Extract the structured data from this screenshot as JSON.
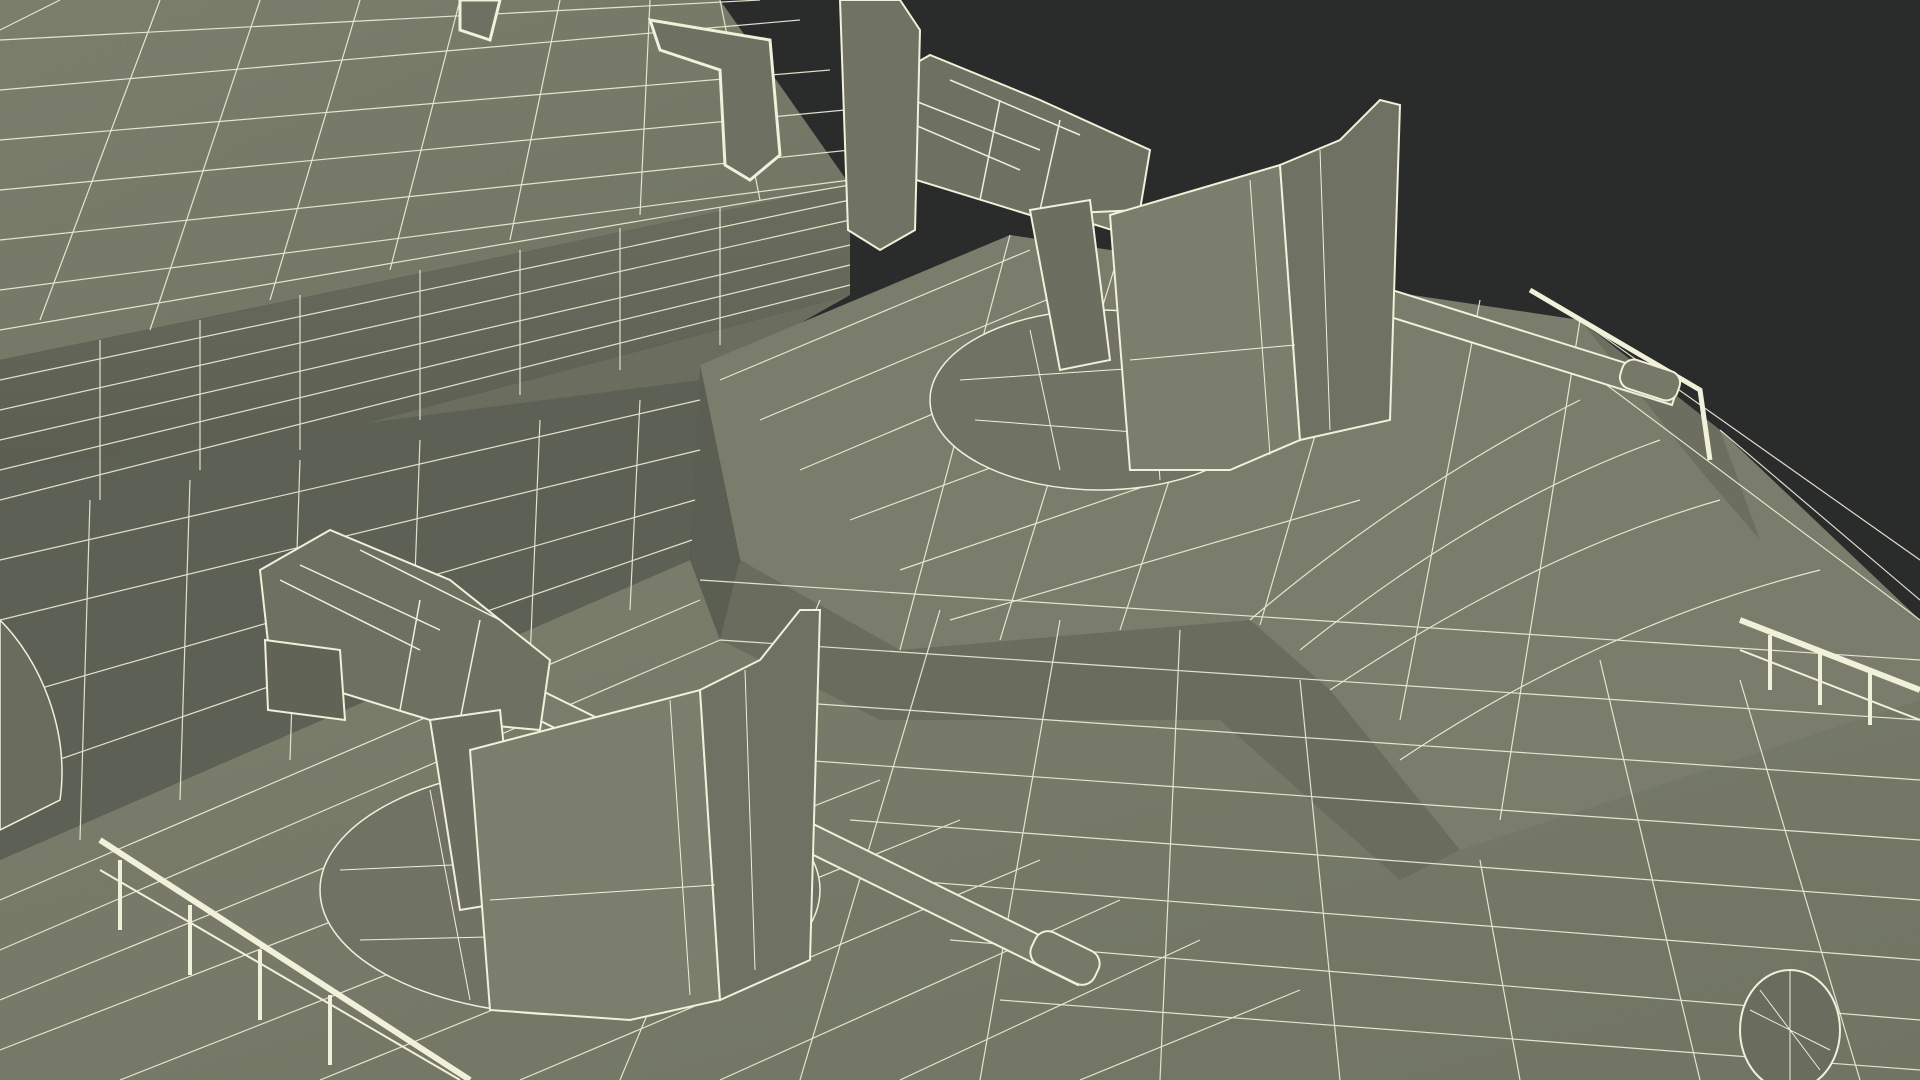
{
  "scene": {
    "background_color": "#2a2b2b",
    "surface_color": "#7d806e",
    "surface_shadow_color": "#5f6255",
    "surface_dark_color": "#4f5248",
    "wire_color": "#f1f0d8"
  }
}
